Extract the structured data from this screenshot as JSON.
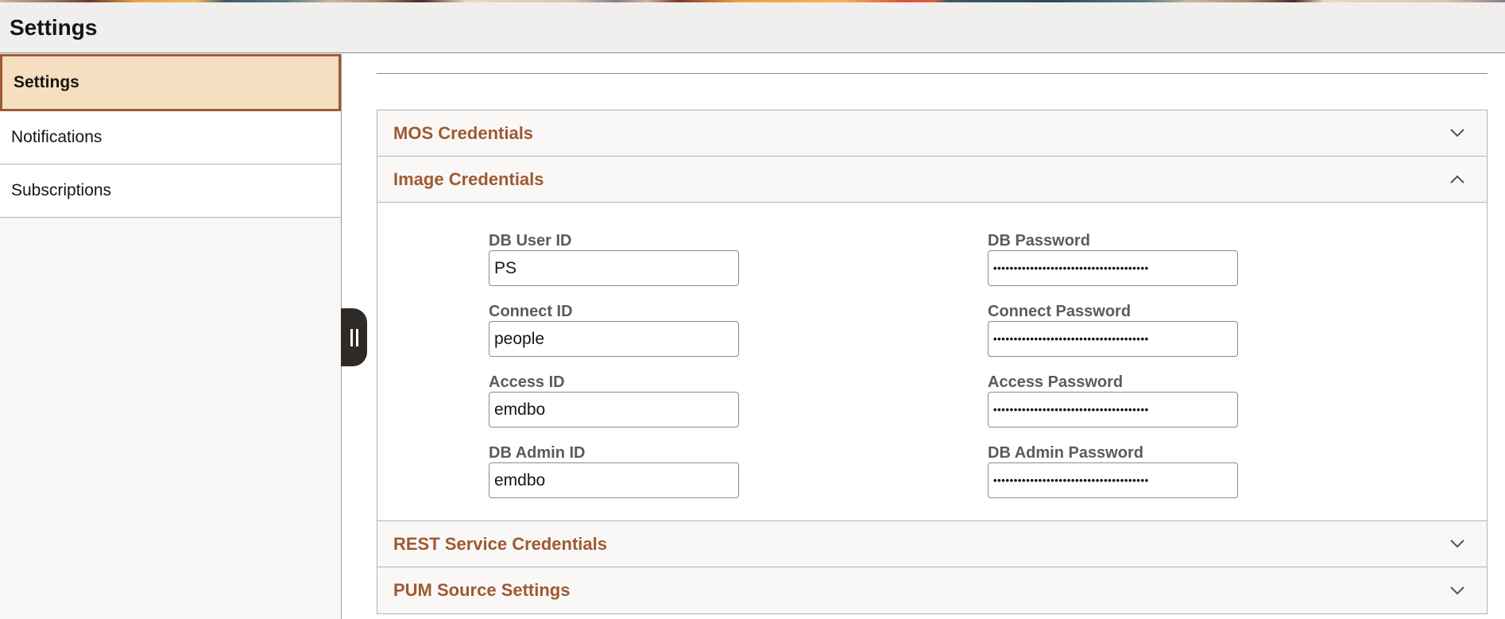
{
  "header": {
    "title": "Settings"
  },
  "sidebar": {
    "items": [
      {
        "label": "Settings",
        "selected": true
      },
      {
        "label": "Notifications",
        "selected": false
      },
      {
        "label": "Subscriptions",
        "selected": false
      }
    ],
    "collapse_handle_icon": "pause-bars-icon"
  },
  "sections": [
    {
      "title": "MOS Credentials",
      "expanded": false,
      "icon": "chevron-down-icon"
    },
    {
      "title": "Image Credentials",
      "expanded": true,
      "icon": "chevron-up-icon"
    },
    {
      "title": "REST Service Credentials",
      "expanded": false,
      "icon": "chevron-down-icon"
    },
    {
      "title": "PUM Source Settings",
      "expanded": false,
      "icon": "chevron-down-icon"
    }
  ],
  "image_credentials": {
    "db_user_id": {
      "label": "DB User ID",
      "value": "PS"
    },
    "db_password": {
      "label": "DB Password",
      "value": "••••••••••••••••••••••••••••••••••••••"
    },
    "connect_id": {
      "label": "Connect ID",
      "value": "people"
    },
    "connect_password": {
      "label": "Connect Password",
      "value": "••••••••••••••••••••••••••••••••••••••"
    },
    "access_id": {
      "label": "Access ID",
      "value": "emdbo"
    },
    "access_password": {
      "label": "Access Password",
      "value": "••••••••••••••••••••••••••••••••••••••"
    },
    "db_admin_id": {
      "label": "DB Admin ID",
      "value": "emdbo"
    },
    "db_admin_password": {
      "label": "DB Admin Password",
      "value": "••••••••••••••••••••••••••••••••••••••"
    }
  },
  "colors": {
    "accent": "#9e5a32",
    "selected_bg": "#f5dfc0",
    "header_bg": "#f1efed",
    "label_gray": "#5e5b57"
  }
}
